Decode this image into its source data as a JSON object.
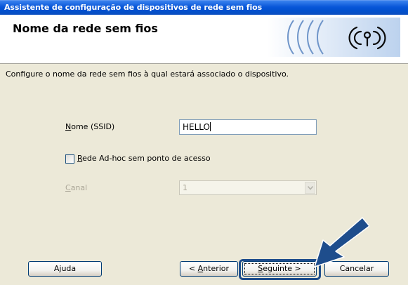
{
  "window": {
    "title": "Assistente de configuração de dispositivos de rede sem fios"
  },
  "header": {
    "page_title": "Nome da rede sem fios"
  },
  "main": {
    "description": "Configure o nome da rede sem fios à qual estará associado o dispositivo.",
    "ssid": {
      "label_mnemonic": "N",
      "label_rest": "ome (SSID)",
      "value": "HELLO"
    },
    "adhoc": {
      "label_mnemonic": "R",
      "label_rest": "ede Ad-hoc sem ponto de acesso",
      "checked": false
    },
    "channel": {
      "label_mnemonic": "C",
      "label_rest": "anal",
      "value": "1",
      "disabled": true
    }
  },
  "footer": {
    "help": "Ajuda",
    "back_prefix": "< ",
    "back_mnemonic": "A",
    "back_rest": "nterior",
    "next_mnemonic": "S",
    "next_rest": "eguinte >",
    "cancel": "Cancelar"
  },
  "colors": {
    "titlebar": "#0856d8",
    "annotation": "#1e4d8c"
  }
}
